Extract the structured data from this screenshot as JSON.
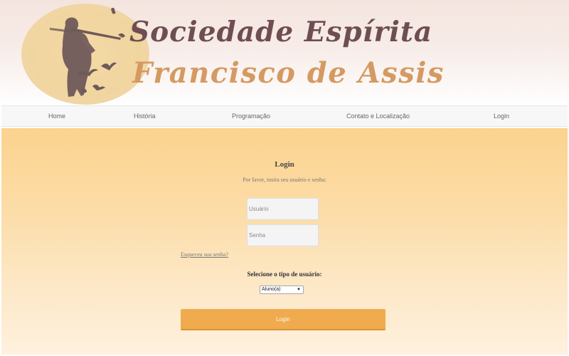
{
  "header": {
    "title_line1": "Sociedade Espírita",
    "title_line2": "Francisco de Assis",
    "logo_icon": "saint-francis-logo-icon"
  },
  "nav": {
    "items": [
      "Home",
      "História",
      "Programação",
      "Contato e Localização",
      "Login"
    ]
  },
  "login": {
    "heading": "Login",
    "subtitle": "Por favor, insira seu usuário e senha:",
    "username_placeholder": "Usuário",
    "password_placeholder": "Senha",
    "forgot_link": "Esqueceu sua senha?",
    "user_type_label": "Selecione o tipo de usuário:",
    "user_type_selected": "Aluno(a)",
    "submit_label": "Login"
  },
  "colors": {
    "title_primary": "#6e4e52",
    "title_secondary": "#d49a62",
    "main_background": "#fbd38f",
    "button": "#efab4e"
  }
}
